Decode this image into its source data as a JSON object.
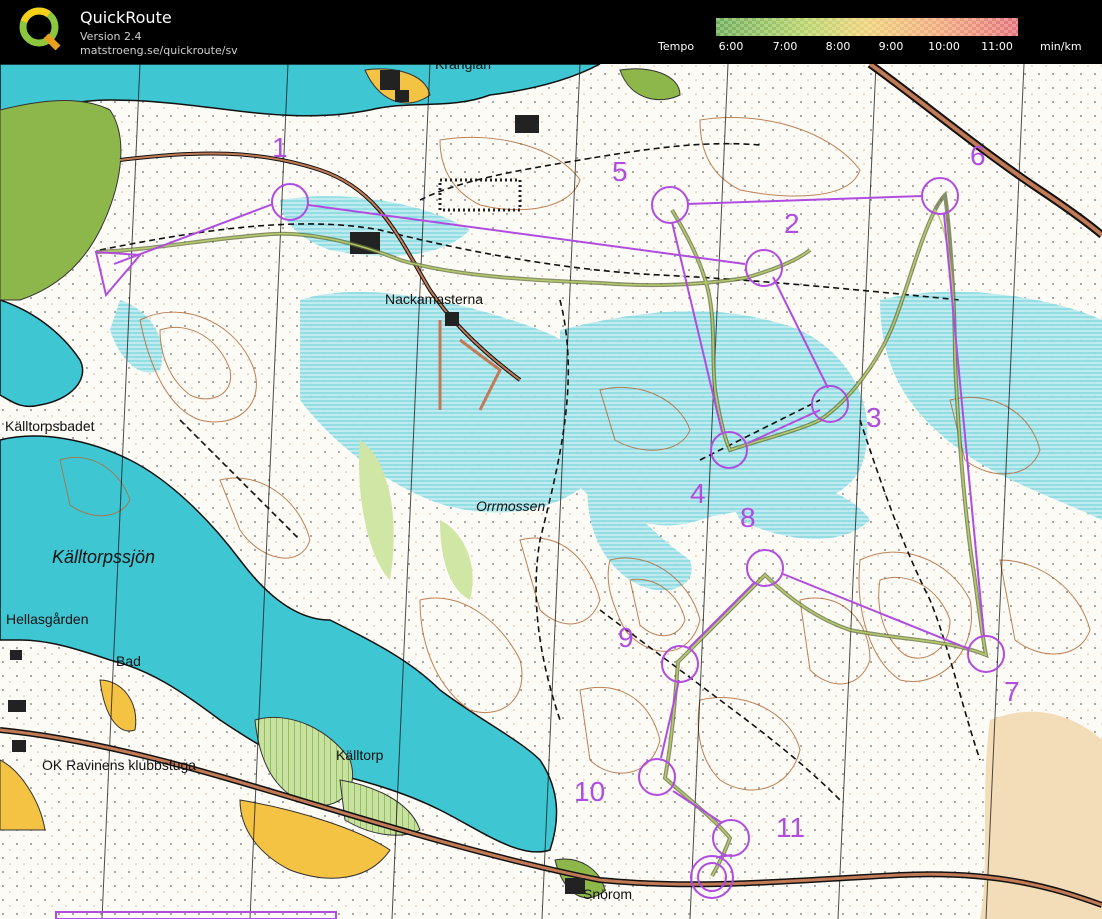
{
  "app": {
    "name": "QuickRoute",
    "version": "Version 2.4",
    "url": "matstroeng.se/quickroute/sv"
  },
  "legend": {
    "label": "Tempo",
    "ticks": [
      "6:00",
      "7:00",
      "8:00",
      "9:00",
      "10:00",
      "11:00"
    ],
    "unit": "min/km",
    "gradient_colors": [
      "#6fae5a",
      "#c9d86a",
      "#eed27a",
      "#f0a87c",
      "#e4737a"
    ]
  },
  "map": {
    "place_names": {
      "krangian": "Krångian",
      "nackamasterna": "Nackamasterna",
      "kalltorpsbadet": "Källtorpsbadet",
      "hellasgarden": "Hellasgården",
      "bad": "Bad",
      "kalltorp": "Källtorp",
      "ok_ravinen": "OK Ravinens klubbstuga",
      "snorom": "Snörom"
    },
    "lake_name": "Källtorpssjön",
    "marsh_name": "Orrmossen",
    "colors": {
      "water": "#3ec7d3",
      "marsh": "#9fe0e6",
      "vegetation": "#8db74a",
      "open": "#f5c343",
      "course": "#b04ce0",
      "route": "#7d8a4f",
      "contour": "#b36b3a",
      "road": "#c27a56"
    },
    "controls": [
      "1",
      "2",
      "3",
      "4",
      "5",
      "6",
      "7",
      "8",
      "9",
      "10",
      "11"
    ]
  }
}
